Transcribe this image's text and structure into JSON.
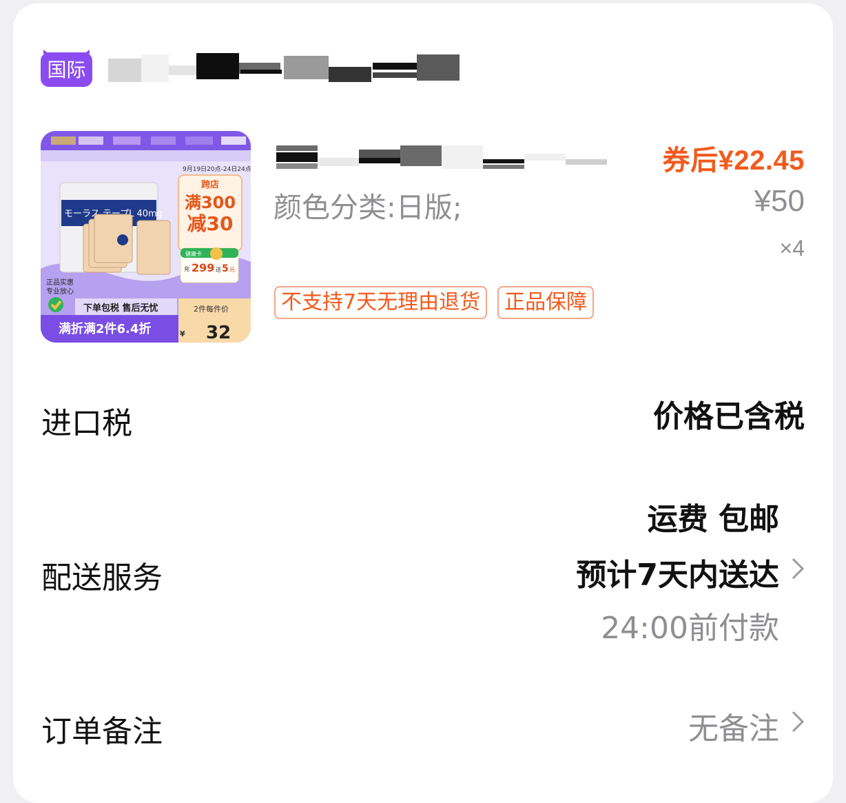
{
  "store": {
    "badge_text": "国际",
    "badge_color": "#8a4cf0",
    "name": ""
  },
  "product": {
    "title": "",
    "price_after_coupon": "券后¥22.45",
    "variant": "颜色分类:日版;",
    "original_price": "¥50",
    "quantity": "×4",
    "tags": [
      "不支持7天无理由退货",
      "正品保障"
    ],
    "thumbnail": {
      "icon": "product-image",
      "promo_date": "9月19日20点-24日24点",
      "cross_store_label": "跨店",
      "discount_line1": "满300",
      "discount_line2": "减30",
      "health_card_label": "健康卡",
      "health_card_value": "充",
      "health_card_amount": "299",
      "health_card_bonus": "送",
      "health_card_bonus_amount": "5",
      "health_card_bonus_unit": "元",
      "product_name_jp": "モーラス テープL 40mg",
      "authentic_line1": "正品实惠",
      "authentic_line2": "专业放心",
      "tax_line": "下单包税 售后无忧",
      "bottom_promo": "满折满2件6.4折",
      "per_item_label": "2件每件价",
      "currency": "¥",
      "per_item_price": "32"
    }
  },
  "rows": {
    "import_tax": {
      "label": "进口税",
      "value": "价格已含税"
    },
    "delivery": {
      "label": "配送服务",
      "shipping": "运费 包邮",
      "eta": "预计7天内送达",
      "payment_deadline": "24:00前付款"
    },
    "note": {
      "label": "订单备注",
      "value": "无备注"
    }
  },
  "colors": {
    "accent_orange": "#f25a1c",
    "tag_border": "#f4a58a",
    "grey_text": "#8e8e93",
    "badge_purple": "#8a4cf0"
  }
}
